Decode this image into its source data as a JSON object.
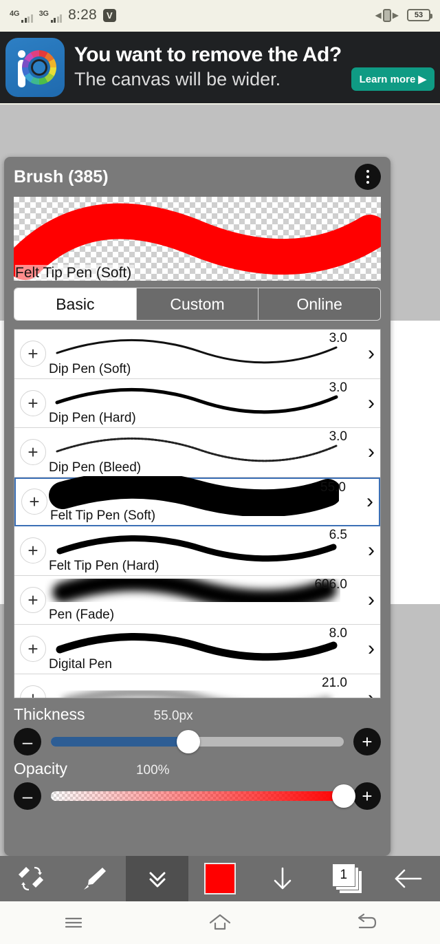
{
  "status_bar": {
    "network_1": "4G",
    "network_2": "3G",
    "time": "8:28",
    "carrier_badge": "V",
    "battery_level": "53"
  },
  "ad": {
    "headline": "You want to remove the Ad?",
    "subline": "The canvas will be wider.",
    "cta": "Learn more ▶",
    "cta_color": "#0f9b84",
    "background": "#1f2123"
  },
  "panel": {
    "title": "Brush (385)",
    "menu_icon": "kebab-menu-icon",
    "preview_label": "Felt Tip Pen (Soft)",
    "preview_stroke_color": "#ff0000",
    "tabs": [
      {
        "label": "Basic",
        "active": true
      },
      {
        "label": "Custom",
        "active": false
      },
      {
        "label": "Online",
        "active": false
      }
    ]
  },
  "brushes": [
    {
      "name": "Dip Pen (Soft)",
      "size": "3.0",
      "selected": false
    },
    {
      "name": "Dip Pen (Hard)",
      "size": "3.0",
      "selected": false
    },
    {
      "name": "Dip Pen (Bleed)",
      "size": "3.0",
      "selected": false
    },
    {
      "name": "Felt Tip Pen (Soft)",
      "size": "55.0",
      "selected": true
    },
    {
      "name": "Felt Tip Pen (Hard)",
      "size": "6.5",
      "selected": false
    },
    {
      "name": "Pen (Fade)",
      "size": "606.0",
      "selected": false
    },
    {
      "name": "Digital Pen",
      "size": "8.0",
      "selected": false
    },
    {
      "name": "",
      "size": "21.0",
      "selected": false
    }
  ],
  "thickness": {
    "label": "Thickness",
    "value": "55.0px",
    "percent": 47,
    "minus": "–",
    "plus": "+",
    "fill_color": "#2d5d94"
  },
  "opacity": {
    "label": "Opacity",
    "value": "100%",
    "percent": 100,
    "minus": "–",
    "plus": "+",
    "fill_color": "#ff0000"
  },
  "toolbar": {
    "items": [
      {
        "icon": "pen-eraser-swap-icon",
        "label": ""
      },
      {
        "icon": "brush-icon",
        "label": ""
      },
      {
        "icon": "double-chevron-down-icon",
        "label": ""
      },
      {
        "icon": "color-swatch-icon",
        "label": "",
        "color": "#ff0000"
      },
      {
        "icon": "arrow-down-icon",
        "label": ""
      },
      {
        "icon": "layers-icon",
        "label": "1"
      },
      {
        "icon": "arrow-left-icon",
        "label": ""
      }
    ]
  },
  "navbar": {
    "items": [
      {
        "icon": "recents-menu-icon"
      },
      {
        "icon": "home-icon"
      },
      {
        "icon": "back-icon"
      }
    ]
  }
}
